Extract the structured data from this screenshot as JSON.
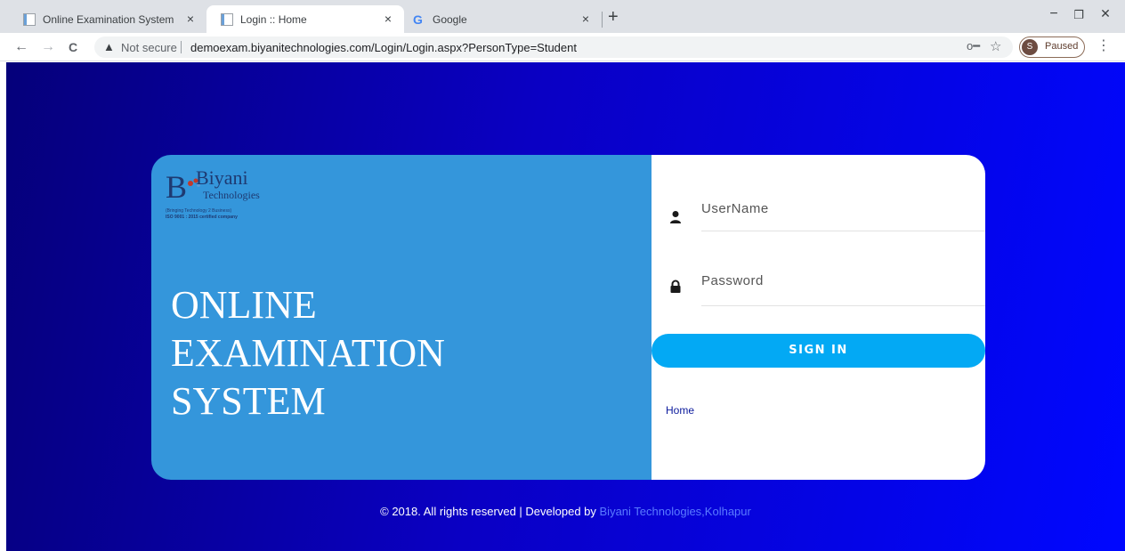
{
  "browser": {
    "tabs": [
      {
        "title": "Online Examination System",
        "active": false
      },
      {
        "title": "Login :: Home",
        "active": true
      },
      {
        "title": "Google",
        "active": false
      }
    ],
    "close_glyph": "×",
    "new_tab_glyph": "+",
    "window_controls": {
      "minimize": "−",
      "restore": "❐",
      "close": "✕"
    },
    "nav": {
      "back": "←",
      "forward": "→",
      "reload": "C"
    },
    "security_label": "Not secure",
    "url": "demoexam.biyanitechnologies.com/Login/Login.aspx?PersonType=Student",
    "profile": {
      "initial": "S",
      "status": "Paused"
    },
    "icons": {
      "warning": "warning-icon",
      "key": "key-icon",
      "star": "star-icon",
      "menu": "kebab-menu-icon"
    }
  },
  "brand": {
    "name": "Biyani",
    "sub": "Technologies",
    "tagline": "(Bringing Technology 2 Business)",
    "iso": "ISO 9001 : 2015 certified company"
  },
  "title_lines": [
    "ONLINE",
    "EXAMINATION",
    "SYSTEM"
  ],
  "form": {
    "username_placeholder": "UserName",
    "password_placeholder": "Password",
    "signin_label": "SIGN IN",
    "home_link": "Home"
  },
  "footer": {
    "text": "© 2018. All rights reserved | Developed by ",
    "developer": "Biyani Technologies,Kolhapur"
  },
  "colors": {
    "card_left": "#3496db",
    "signin": "#03a9f4",
    "page_gradient_start": "#05007a",
    "page_gradient_end": "#0007ff"
  }
}
